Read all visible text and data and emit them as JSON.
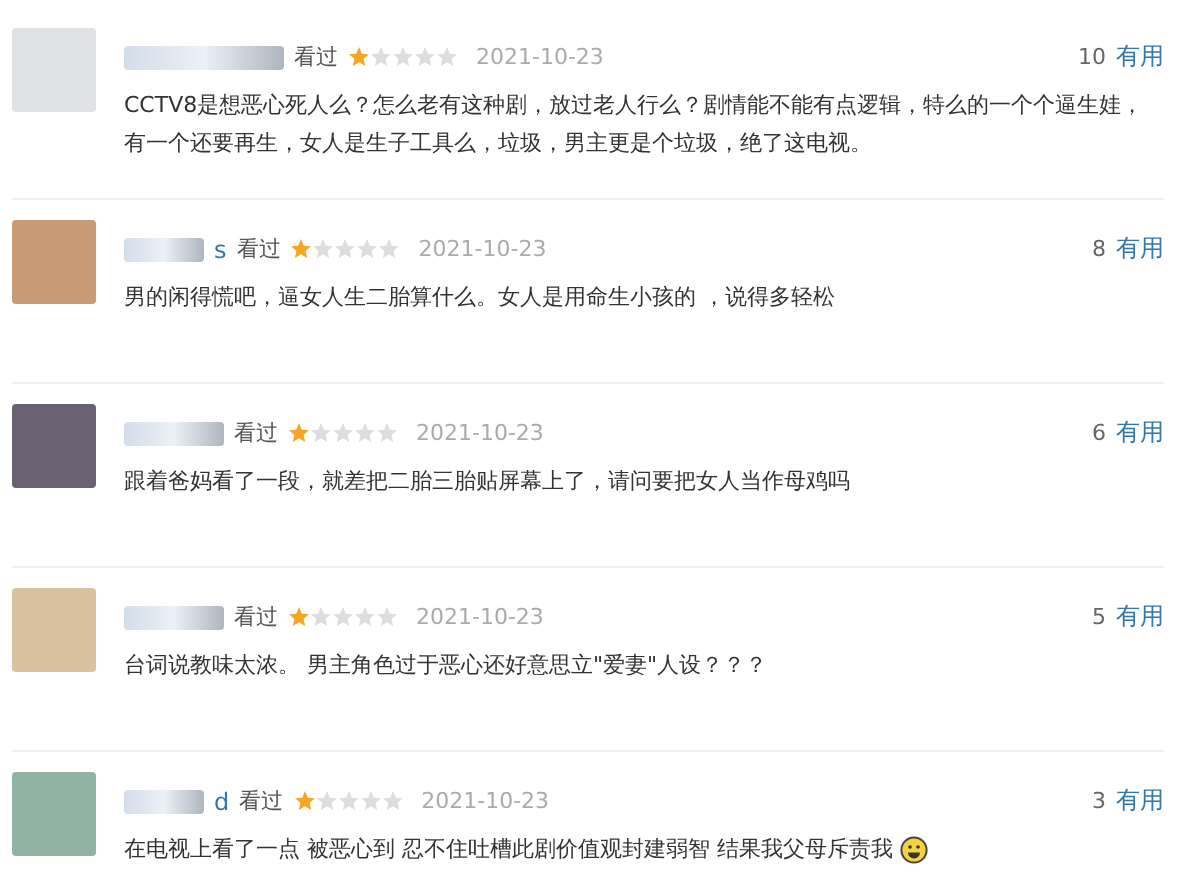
{
  "reviews": [
    {
      "status": "看过",
      "stars": 1,
      "date": "2021-10-23",
      "votes": "10",
      "vote_label": "有用",
      "text": "CCTV8是想恶心死人么？怎么老有这种剧，放过老人行么？剧情能不能有点逻辑，特么的一个个逼生娃，有一个还要再生，女人是生子工具么，垃圾，男主更是个垃圾，绝了这电视。"
    },
    {
      "user": "s",
      "status": "看过",
      "stars": 1,
      "date": "2021-10-23",
      "votes": "8",
      "vote_label": "有用",
      "text": "男的闲得慌吧，逼女人生二胎算什么。女人是用命生小孩的 ，说得多轻松"
    },
    {
      "status": "看过",
      "stars": 1,
      "date": "2021-10-23",
      "votes": "6",
      "vote_label": "有用",
      "text": "跟着爸妈看了一段，就差把二胎三胎贴屏幕上了，请问要把女人当作母鸡吗"
    },
    {
      "status": "看过",
      "stars": 1,
      "date": "2021-10-23",
      "votes": "5",
      "vote_label": "有用",
      "text": "台词说教味太浓。 男主角色过于恶心还好意思立\"爱妻\"人设？？？"
    },
    {
      "user": "d",
      "status": "看过",
      "stars": 1,
      "date": "2021-10-23",
      "votes": "3",
      "vote_label": "有用",
      "text": "在电视上看了一点 被恶心到 忍不住吐槽此剧价值观封建弱智 结果我父母斥责我",
      "emoji": true
    }
  ]
}
